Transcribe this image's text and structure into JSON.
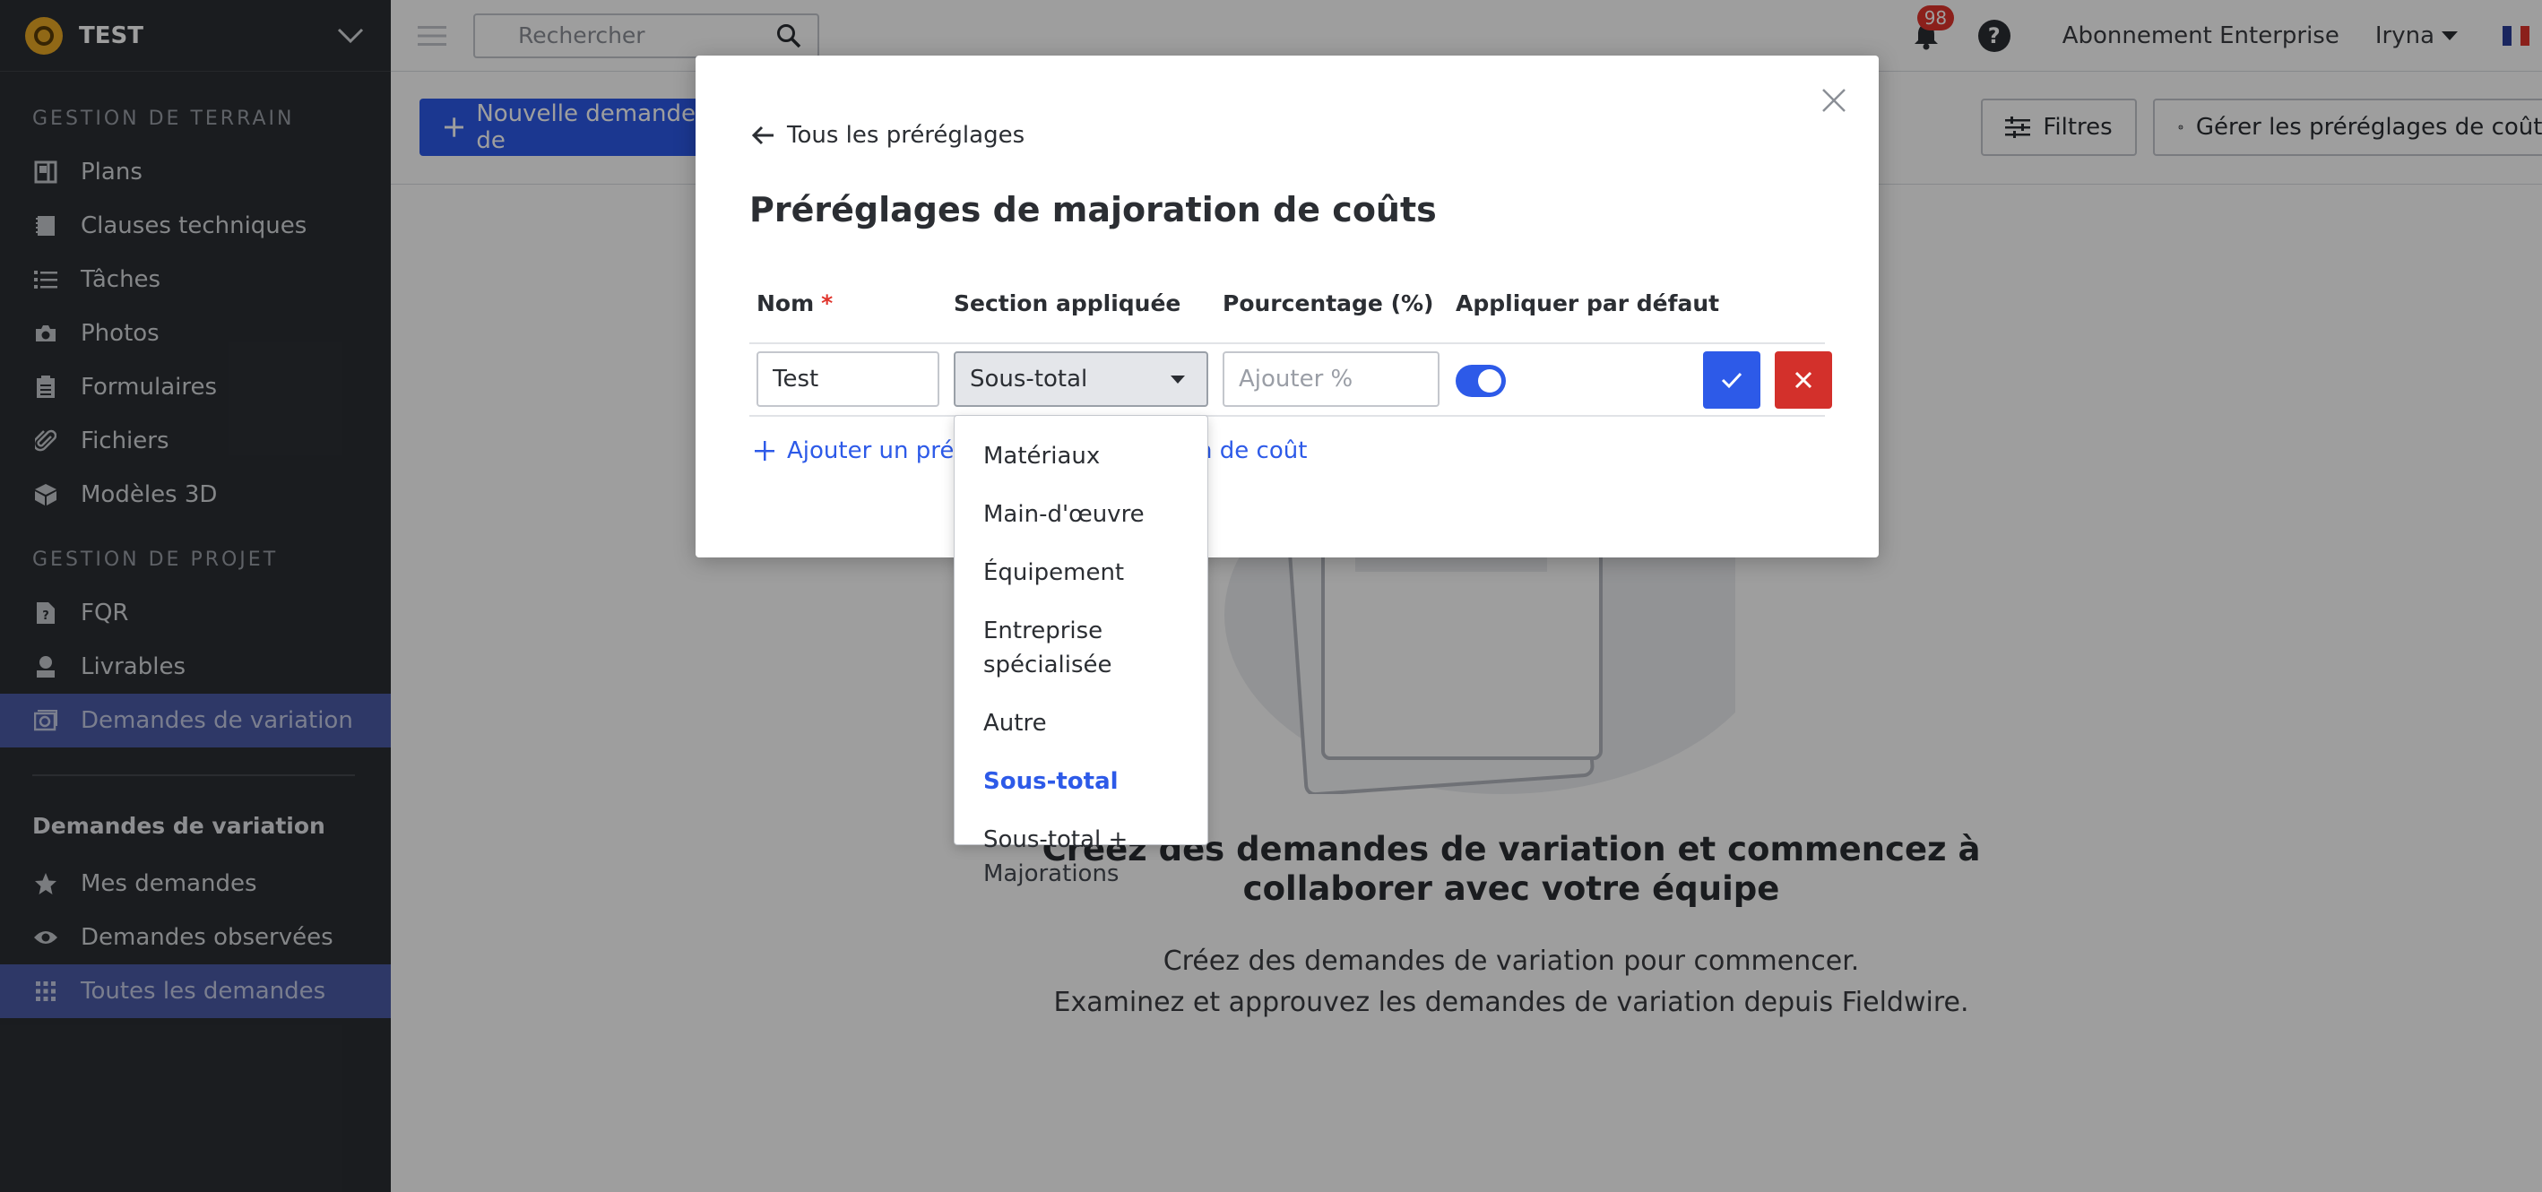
{
  "project": {
    "name": "TEST"
  },
  "sidebar": {
    "section_terrain": "GESTION DE TERRAIN",
    "terrain_items": [
      {
        "label": "Plans",
        "icon": "plans-icon"
      },
      {
        "label": "Clauses techniques",
        "icon": "specs-icon"
      },
      {
        "label": "Tâches",
        "icon": "tasks-icon"
      },
      {
        "label": "Photos",
        "icon": "camera-icon"
      },
      {
        "label": "Formulaires",
        "icon": "forms-icon"
      },
      {
        "label": "Fichiers",
        "icon": "paperclip-icon"
      },
      {
        "label": "Modèles 3D",
        "icon": "cube-icon"
      }
    ],
    "section_projet": "GESTION DE PROJET",
    "projet_items": [
      {
        "label": "FQR",
        "icon": "rfi-icon"
      },
      {
        "label": "Livrables",
        "icon": "submittals-icon"
      },
      {
        "label": "Demandes de variation",
        "icon": "change-orders-icon"
      }
    ],
    "sub_heading": "Demandes de variation",
    "sub_items": [
      {
        "label": "Mes demandes",
        "icon": "star-icon"
      },
      {
        "label": "Demandes observées",
        "icon": "eye-icon"
      },
      {
        "label": "Toutes les demandes",
        "icon": "grid-icon"
      }
    ]
  },
  "topbar": {
    "search_placeholder": "Rechercher",
    "notification_count": "98",
    "help": "?",
    "plan_label": "Abonnement Enterprise",
    "user_name": "Iryna"
  },
  "toolbar": {
    "new_label": "Nouvelle demande de",
    "filters_label": "Filtres",
    "manage_label": "Gérer les préréglages de coûts"
  },
  "empty_state": {
    "title": "Créez des demandes de variation et commencez à collaborer avec votre équipe",
    "line1": "Créez des demandes de variation pour commencer.",
    "line2": "Examinez et approuvez les demandes de variation depuis Fieldwire."
  },
  "modal": {
    "back_label": "Tous les préréglages",
    "title": "Préréglages de majoration de coûts",
    "columns": {
      "name": "Nom",
      "required_mark": "*",
      "section": "Section appliquée",
      "percentage": "Pourcentage (%)",
      "default": "Appliquer par défaut"
    },
    "row": {
      "name_value": "Test",
      "section_value": "Sous-total",
      "percentage_placeholder": "Ajouter %",
      "apply_default": true
    },
    "add_label": "Ajouter un préréglage de majoration de coût"
  },
  "dropdown": {
    "options": [
      "Matériaux",
      "Main-d'œuvre",
      "Équipement",
      "Entreprise spécialisée",
      "Autre",
      "Sous-total",
      "Sous-total + Majorations"
    ],
    "selected": "Sous-total"
  },
  "colors": {
    "sidebar_bg": "#2b2e33",
    "accent": "#2d5ae8",
    "danger": "#d3302b",
    "active_nav": "#4b5ba7"
  }
}
